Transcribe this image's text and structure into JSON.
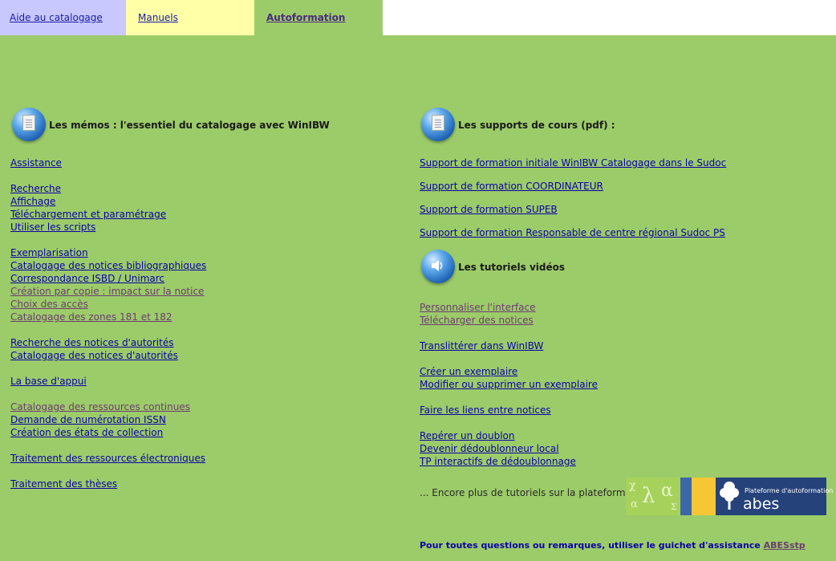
{
  "tabs": {
    "aide": "Aide au catalogage",
    "manuels": "Manuels",
    "autoformation": "Autoformation"
  },
  "memos": {
    "title": "Les mémos : l'essentiel du catalogage avec WinIBW",
    "groups": [
      [
        "Assistance"
      ],
      [
        "Recherche",
        "Affichage",
        "Téléchargement et paramétrage",
        "Utiliser les scripts"
      ],
      [
        "Exemplarisation",
        "Catalogage des notices bibliographiques",
        "Correspondance ISBD / Unimarc",
        "Création par copie : impact sur la notice",
        "Choix des accès",
        "Catalogage des zones 181 et 182"
      ],
      [
        "Recherche des notices d'autorités",
        "Catalogage des notices d'autorités"
      ],
      [
        "La base d'appui"
      ],
      [
        "Catalogage des ressources continues",
        "Demande de numérotation ISSN",
        "Création des états de collection"
      ],
      [
        "Traitement des ressources électroniques"
      ],
      [
        "Traitement des thèses"
      ]
    ]
  },
  "supports": {
    "title": "Les supports de cours (pdf) :",
    "items": [
      "Support de formation initiale WinIBW Catalogage dans le Sudoc",
      "Support de formation COORDINATEUR",
      "Support de formation SUPEB",
      "Support de formation Responsable de centre régional Sudoc PS"
    ]
  },
  "tutoriels": {
    "title": "Les tutoriels vidéos",
    "groups": [
      [
        "Personnaliser l'interface",
        "Télécharger des notices"
      ],
      [
        "Translittérer dans WinIBW"
      ],
      [
        "Créer un exemplaire",
        "Modifier ou supprimer un exemplaire"
      ],
      [
        "Faire les liens entre notices"
      ],
      [
        "Repérer un doublon",
        "Devenir dédoublonneur local",
        "TP interactifs de dédoublonnage"
      ]
    ]
  },
  "more": {
    "text": "... Encore plus de tutoriels sur la plateforme",
    "banner_label": "Plateforme d'autoformation",
    "banner_brand": "abes"
  },
  "footer": {
    "text": "Pour toutes questions ou remarques, utiliser le guichet d'assistance",
    "link": "ABESstp"
  },
  "colors": {
    "background": "#9ccc69",
    "link": "#0b00a8",
    "visited": "#6c3b72"
  }
}
